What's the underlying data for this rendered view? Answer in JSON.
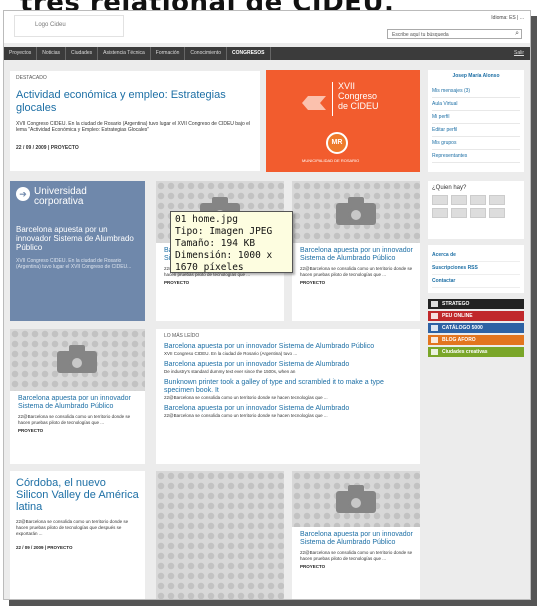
{
  "heading_cut": "tres relational de CIDEU.",
  "header": {
    "logo_label": "Logo Cideu",
    "lang": "Idioma: ES | ...",
    "search_placeholder": "Escribe aquí tu búsqueda"
  },
  "nav": {
    "items": [
      "Proyectos",
      "Noticias",
      "Ciudades",
      "Asistencia Técnica",
      "Formación",
      "Conocimiento",
      "CONGRESOS"
    ],
    "right": "Salir"
  },
  "featured": {
    "label": "DESTACADO",
    "title": "Actividad económica y empleo: Estrategias glocales",
    "text": "XVII Congreso CIDEU. En la ciudad de Rosario (Argentina) tuvo lugar el XVII Congreso de CIDEU bajo el lema \"Actividad Económica y Empleo: Estrategias Glocales\"",
    "meta": "22 / 09 / 2009 | PROYECTO"
  },
  "banner": {
    "line1": "XVII",
    "line2": "Congreso",
    "line3": "de CIDEU",
    "badge": "MR",
    "footer": "MUNICIPALIDAD DE ROSARIO"
  },
  "user_panel": {
    "name": "Josep María Alonso",
    "links": [
      "Mis mensajes (3)",
      "Aula Virtual",
      "Mi perfil",
      "Editar perfil",
      "Mis grupos",
      "Representantes"
    ]
  },
  "uni": {
    "title_1": "Universidad",
    "title_2": "corporativa",
    "subtitle": "Barcelona apuesta por un innovador Sistema de Alumbrado Público",
    "text": "XVII Congreso CIDEU. En la ciudad de Rosario (Argentina) tuvo lugar el XVII Congreso de CIDEU..."
  },
  "article": {
    "title": "Barcelona apuesta por un innovador Sistema de Alumbrado Público",
    "text": "22@Barcelona se consolida como un territorio donde se hacen pruebas piloto de tecnologías que ...",
    "tag": "PROYECTO"
  },
  "tooltip": {
    "line1": "01 home.jpg",
    "line2": "Tipo: Imagen JPEG",
    "line3": "Tamaño: 194 KB",
    "line4": "Dimensión: 1000 x",
    "line5": "1670 píxeles"
  },
  "quien": {
    "title": "¿Quien hay?"
  },
  "info_links": [
    "Acerca de",
    "Suscripciones RSS",
    "Contactar"
  ],
  "social": [
    {
      "label": "STRATEGO",
      "color": "#222222"
    },
    {
      "label": "PEU ONLINE",
      "color": "#c0282b"
    },
    {
      "label": "CATÁLOGO 5000",
      "color": "#2e62a4"
    },
    {
      "label": "BLOG AFORO",
      "color": "#e2751f"
    },
    {
      "label": "Ciudades creativas",
      "color": "#7aa629"
    }
  ],
  "mas_leido": {
    "label": "LO MÁS LEÍDO",
    "items": [
      {
        "title": "Barcelona apuesta por un innovador Sistema de Alumbrado Público",
        "text": "XVII Congreso CIDEU. En la ciudad de Rosario (Argentina) tuvo ..."
      },
      {
        "title": "Barcelona apuesta por un innovador Sistema de Alumbrado",
        "text": "De industry's standard dummy text ever since the 1500s, when an"
      },
      {
        "title": "Bunknown printer took a galley of type and scrambled it to make a type specimen book. It",
        "text": "22@Barcelona se consolida como un territorio donde se hacen tecnologías que ..."
      },
      {
        "title": "Barcelona apuesta por un innovador Sistema de Alumbrado",
        "text": "22@Barcelona se consolida como un territorio donde se hacen tecnologías que ..."
      }
    ]
  },
  "cordoba": {
    "title": "Córdoba, el nuevo Silicon Valley de América latina",
    "text": "22@Barcelona se consolida como un territorio donde se hacen pruebas piloto de tecnologías que después se exportarán ...",
    "meta": "22 / 09 / 2009 | PROYECTO"
  }
}
